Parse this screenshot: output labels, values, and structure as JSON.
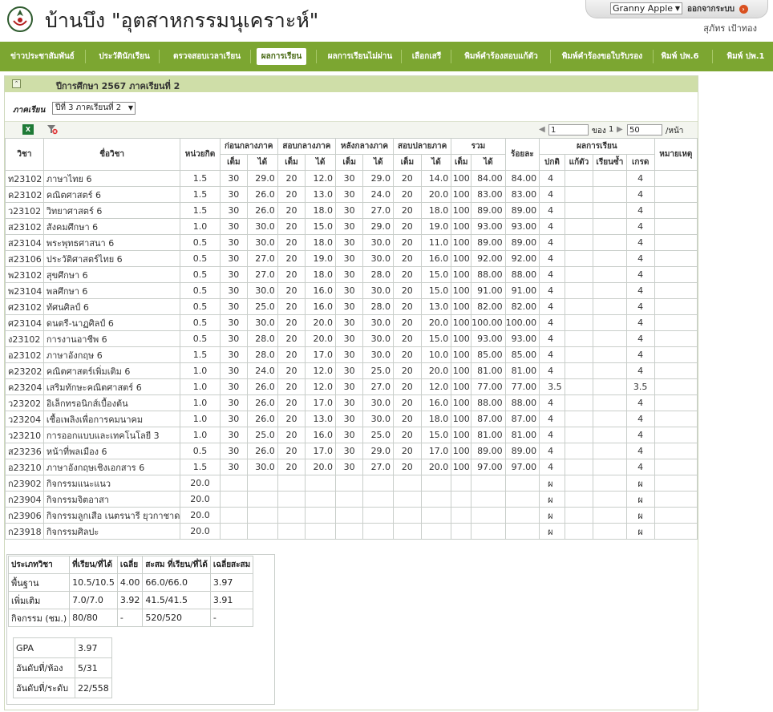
{
  "header": {
    "site_title": "บ้านบึง \"อุตสาหกรรมนุเคราะห์\"",
    "user_select_value": "Granny Apple",
    "logout_label": "ออกจากระบบ",
    "user_name": "สุภัทร เป้าทอง"
  },
  "nav": {
    "items": [
      {
        "label": "ข่าวประชาสัมพันธ์"
      },
      {
        "label": "ประวัตินักเรียน"
      },
      {
        "label": "ตรวจสอบเวลาเรียน"
      },
      {
        "label": "ผลการเรียน"
      },
      {
        "label": "ผลการเรียนไม่ผ่าน"
      },
      {
        "label": "เลือกเสรี"
      },
      {
        "label": "พิมพ์คำร้องสอบแก้ตัว"
      },
      {
        "label": "พิมพ์คำร้องขอใบรับรอง"
      },
      {
        "label": "พิมพ์ ปพ.6"
      },
      {
        "label": "พิมพ์ ปพ.1"
      }
    ],
    "active_index": 3
  },
  "panel": {
    "title": "ปีการศึกษา 2567 ภาคเรียนที่ 2",
    "term_label": "ภาคเรียน",
    "term_value": "ปีที่ 3 ภาคเรียนที่ 2"
  },
  "pager": {
    "page": "1",
    "of_label": "ของ",
    "total_pages": "1",
    "per_page": "50",
    "per_page_label": "/หน้า"
  },
  "columns": {
    "code": "วิชา",
    "name": "ชื่อวิชา",
    "credit": "หน่วยกิต",
    "groups": [
      "ก่อนกลางภาค",
      "สอบกลางภาค",
      "หลังกลางภาค",
      "สอบปลายภาค",
      "รวม"
    ],
    "full": "เต็ม",
    "got": "ได้",
    "percent": "ร้อยละ",
    "result": "ผลการเรียน",
    "normal": "ปกติ",
    "retake": "แก้ตัว",
    "repeat": "เรียนซ้ำ",
    "grade": "เกรด",
    "note": "หมายเหตุ"
  },
  "rows": [
    {
      "code": "ท23102",
      "name": "ภาษาไทย 6",
      "credit": "1.5",
      "b_full": "30",
      "b_got": "29.0",
      "m_full": "20",
      "m_got": "12.0",
      "a_full": "30",
      "a_got": "29.0",
      "f_full": "20",
      "f_got": "14.0",
      "t_full": "100",
      "t_got": "84.00",
      "pct": "84.00",
      "normal": "4",
      "retake": "",
      "repeat": "",
      "grade": "4",
      "note": ""
    },
    {
      "code": "ค23102",
      "name": "คณิตศาสตร์ 6",
      "credit": "1.5",
      "b_full": "30",
      "b_got": "26.0",
      "m_full": "20",
      "m_got": "13.0",
      "a_full": "30",
      "a_got": "24.0",
      "f_full": "20",
      "f_got": "20.0",
      "t_full": "100",
      "t_got": "83.00",
      "pct": "83.00",
      "normal": "4",
      "retake": "",
      "repeat": "",
      "grade": "4",
      "note": ""
    },
    {
      "code": "ว23102",
      "name": "วิทยาศาสตร์ 6",
      "credit": "1.5",
      "b_full": "30",
      "b_got": "26.0",
      "m_full": "20",
      "m_got": "18.0",
      "a_full": "30",
      "a_got": "27.0",
      "f_full": "20",
      "f_got": "18.0",
      "t_full": "100",
      "t_got": "89.00",
      "pct": "89.00",
      "normal": "4",
      "retake": "",
      "repeat": "",
      "grade": "4",
      "note": ""
    },
    {
      "code": "ส23102",
      "name": "สังคมศึกษา 6",
      "credit": "1.0",
      "b_full": "30",
      "b_got": "30.0",
      "m_full": "20",
      "m_got": "15.0",
      "a_full": "30",
      "a_got": "29.0",
      "f_full": "20",
      "f_got": "19.0",
      "t_full": "100",
      "t_got": "93.00",
      "pct": "93.00",
      "normal": "4",
      "retake": "",
      "repeat": "",
      "grade": "4",
      "note": ""
    },
    {
      "code": "ส23104",
      "name": "พระพุทธศาสนา 6",
      "credit": "0.5",
      "b_full": "30",
      "b_got": "30.0",
      "m_full": "20",
      "m_got": "18.0",
      "a_full": "30",
      "a_got": "30.0",
      "f_full": "20",
      "f_got": "11.0",
      "t_full": "100",
      "t_got": "89.00",
      "pct": "89.00",
      "normal": "4",
      "retake": "",
      "repeat": "",
      "grade": "4",
      "note": ""
    },
    {
      "code": "ส23106",
      "name": "ประวัติศาสตร์ไทย 6",
      "credit": "0.5",
      "b_full": "30",
      "b_got": "27.0",
      "m_full": "20",
      "m_got": "19.0",
      "a_full": "30",
      "a_got": "30.0",
      "f_full": "20",
      "f_got": "16.0",
      "t_full": "100",
      "t_got": "92.00",
      "pct": "92.00",
      "normal": "4",
      "retake": "",
      "repeat": "",
      "grade": "4",
      "note": ""
    },
    {
      "code": "พ23102",
      "name": "สุขศึกษา 6",
      "credit": "0.5",
      "b_full": "30",
      "b_got": "27.0",
      "m_full": "20",
      "m_got": "18.0",
      "a_full": "30",
      "a_got": "28.0",
      "f_full": "20",
      "f_got": "15.0",
      "t_full": "100",
      "t_got": "88.00",
      "pct": "88.00",
      "normal": "4",
      "retake": "",
      "repeat": "",
      "grade": "4",
      "note": ""
    },
    {
      "code": "พ23104",
      "name": "พลศึกษา 6",
      "credit": "0.5",
      "b_full": "30",
      "b_got": "30.0",
      "m_full": "20",
      "m_got": "16.0",
      "a_full": "30",
      "a_got": "30.0",
      "f_full": "20",
      "f_got": "15.0",
      "t_full": "100",
      "t_got": "91.00",
      "pct": "91.00",
      "normal": "4",
      "retake": "",
      "repeat": "",
      "grade": "4",
      "note": ""
    },
    {
      "code": "ศ23102",
      "name": "ทัศนศิลป์ 6",
      "credit": "0.5",
      "b_full": "30",
      "b_got": "25.0",
      "m_full": "20",
      "m_got": "16.0",
      "a_full": "30",
      "a_got": "28.0",
      "f_full": "20",
      "f_got": "13.0",
      "t_full": "100",
      "t_got": "82.00",
      "pct": "82.00",
      "normal": "4",
      "retake": "",
      "repeat": "",
      "grade": "4",
      "note": ""
    },
    {
      "code": "ศ23104",
      "name": "ดนตรี-นาฏศิลป์ 6",
      "credit": "0.5",
      "b_full": "30",
      "b_got": "30.0",
      "m_full": "20",
      "m_got": "20.0",
      "a_full": "30",
      "a_got": "30.0",
      "f_full": "20",
      "f_got": "20.0",
      "t_full": "100",
      "t_got": "100.00",
      "pct": "100.00",
      "normal": "4",
      "retake": "",
      "repeat": "",
      "grade": "4",
      "note": ""
    },
    {
      "code": "ง23102",
      "name": "การงานอาชีพ 6",
      "credit": "0.5",
      "b_full": "30",
      "b_got": "28.0",
      "m_full": "20",
      "m_got": "20.0",
      "a_full": "30",
      "a_got": "30.0",
      "f_full": "20",
      "f_got": "15.0",
      "t_full": "100",
      "t_got": "93.00",
      "pct": "93.00",
      "normal": "4",
      "retake": "",
      "repeat": "",
      "grade": "4",
      "note": ""
    },
    {
      "code": "อ23102",
      "name": "ภาษาอังกฤษ 6",
      "credit": "1.5",
      "b_full": "30",
      "b_got": "28.0",
      "m_full": "20",
      "m_got": "17.0",
      "a_full": "30",
      "a_got": "30.0",
      "f_full": "20",
      "f_got": "10.0",
      "t_full": "100",
      "t_got": "85.00",
      "pct": "85.00",
      "normal": "4",
      "retake": "",
      "repeat": "",
      "grade": "4",
      "note": ""
    },
    {
      "code": "ค23202",
      "name": "คณิตศาสตร์เพิ่มเติม 6",
      "credit": "1.0",
      "b_full": "30",
      "b_got": "24.0",
      "m_full": "20",
      "m_got": "12.0",
      "a_full": "30",
      "a_got": "25.0",
      "f_full": "20",
      "f_got": "20.0",
      "t_full": "100",
      "t_got": "81.00",
      "pct": "81.00",
      "normal": "4",
      "retake": "",
      "repeat": "",
      "grade": "4",
      "note": ""
    },
    {
      "code": "ค23204",
      "name": "เสริมทักษะคณิตศาสตร์ 6",
      "credit": "1.0",
      "b_full": "30",
      "b_got": "26.0",
      "m_full": "20",
      "m_got": "12.0",
      "a_full": "30",
      "a_got": "27.0",
      "f_full": "20",
      "f_got": "12.0",
      "t_full": "100",
      "t_got": "77.00",
      "pct": "77.00",
      "normal": "3.5",
      "retake": "",
      "repeat": "",
      "grade": "3.5",
      "note": ""
    },
    {
      "code": "ว23202",
      "name": "อิเล็กทรอนิกส์เบื้องต้น",
      "credit": "1.0",
      "b_full": "30",
      "b_got": "26.0",
      "m_full": "20",
      "m_got": "17.0",
      "a_full": "30",
      "a_got": "30.0",
      "f_full": "20",
      "f_got": "16.0",
      "t_full": "100",
      "t_got": "88.00",
      "pct": "88.00",
      "normal": "4",
      "retake": "",
      "repeat": "",
      "grade": "4",
      "note": ""
    },
    {
      "code": "ว23204",
      "name": "เชื้อเพลิงเพื่อการคมนาคม",
      "credit": "1.0",
      "b_full": "30",
      "b_got": "26.0",
      "m_full": "20",
      "m_got": "13.0",
      "a_full": "30",
      "a_got": "30.0",
      "f_full": "20",
      "f_got": "18.0",
      "t_full": "100",
      "t_got": "87.00",
      "pct": "87.00",
      "normal": "4",
      "retake": "",
      "repeat": "",
      "grade": "4",
      "note": ""
    },
    {
      "code": "ว23210",
      "name": "การออกแบบและเทคโนโลยี 3",
      "credit": "1.0",
      "b_full": "30",
      "b_got": "25.0",
      "m_full": "20",
      "m_got": "16.0",
      "a_full": "30",
      "a_got": "25.0",
      "f_full": "20",
      "f_got": "15.0",
      "t_full": "100",
      "t_got": "81.00",
      "pct": "81.00",
      "normal": "4",
      "retake": "",
      "repeat": "",
      "grade": "4",
      "note": ""
    },
    {
      "code": "ส23236",
      "name": "หน้าที่พลเมือง 6",
      "credit": "0.5",
      "b_full": "30",
      "b_got": "26.0",
      "m_full": "20",
      "m_got": "17.0",
      "a_full": "30",
      "a_got": "29.0",
      "f_full": "20",
      "f_got": "17.0",
      "t_full": "100",
      "t_got": "89.00",
      "pct": "89.00",
      "normal": "4",
      "retake": "",
      "repeat": "",
      "grade": "4",
      "note": ""
    },
    {
      "code": "อ23210",
      "name": "ภาษาอังกฤษเชิงเอกสาร 6",
      "credit": "1.5",
      "b_full": "30",
      "b_got": "30.0",
      "m_full": "20",
      "m_got": "20.0",
      "a_full": "30",
      "a_got": "27.0",
      "f_full": "20",
      "f_got": "20.0",
      "t_full": "100",
      "t_got": "97.00",
      "pct": "97.00",
      "normal": "4",
      "retake": "",
      "repeat": "",
      "grade": "4",
      "note": ""
    },
    {
      "code": "ก23902",
      "name": "กิจกรรมแนะแนว",
      "credit": "20.0",
      "b_full": "",
      "b_got": "",
      "m_full": "",
      "m_got": "",
      "a_full": "",
      "a_got": "",
      "f_full": "",
      "f_got": "",
      "t_full": "",
      "t_got": "",
      "pct": "",
      "normal": "ผ",
      "retake": "",
      "repeat": "",
      "grade": "ผ",
      "note": ""
    },
    {
      "code": "ก23904",
      "name": "กิจกรรมจิตอาสา",
      "credit": "20.0",
      "b_full": "",
      "b_got": "",
      "m_full": "",
      "m_got": "",
      "a_full": "",
      "a_got": "",
      "f_full": "",
      "f_got": "",
      "t_full": "",
      "t_got": "",
      "pct": "",
      "normal": "ผ",
      "retake": "",
      "repeat": "",
      "grade": "ผ",
      "note": ""
    },
    {
      "code": "ก23906",
      "name": "กิจกรรมลูกเสือ เนตรนารี ยุวกาชาด",
      "credit": "20.0",
      "b_full": "",
      "b_got": "",
      "m_full": "",
      "m_got": "",
      "a_full": "",
      "a_got": "",
      "f_full": "",
      "f_got": "",
      "t_full": "",
      "t_got": "",
      "pct": "",
      "normal": "ผ",
      "retake": "",
      "repeat": "",
      "grade": "ผ",
      "note": ""
    },
    {
      "code": "ก23918",
      "name": "กิจกรรมศิลปะ",
      "credit": "20.0",
      "b_full": "",
      "b_got": "",
      "m_full": "",
      "m_got": "",
      "a_full": "",
      "a_got": "",
      "f_full": "",
      "f_got": "",
      "t_full": "",
      "t_got": "",
      "pct": "",
      "normal": "ผ",
      "retake": "",
      "repeat": "",
      "grade": "ผ",
      "note": ""
    }
  ],
  "summary": {
    "headers": [
      "ประเภทวิชา",
      "ที่เรียน/ที่ได้",
      "เฉลี่ย",
      "สะสม ที่เรียน/ที่ได้",
      "เฉลี่ยสะสม"
    ],
    "rows": [
      [
        "พื้นฐาน",
        "10.5/10.5",
        "4.00",
        "66.0/66.0",
        "3.97"
      ],
      [
        "เพิ่มเติม",
        "7.0/7.0",
        "3.92",
        "41.5/41.5",
        "3.91"
      ],
      [
        "กิจกรรม (ชม.)",
        "80/80",
        "-",
        "520/520",
        "-"
      ]
    ],
    "gpa": [
      [
        "GPA",
        "3.97"
      ],
      [
        "อันดับที่/ห้อง",
        "5/31"
      ],
      [
        "อันดับที่/ระดับ",
        "22/558"
      ]
    ]
  }
}
